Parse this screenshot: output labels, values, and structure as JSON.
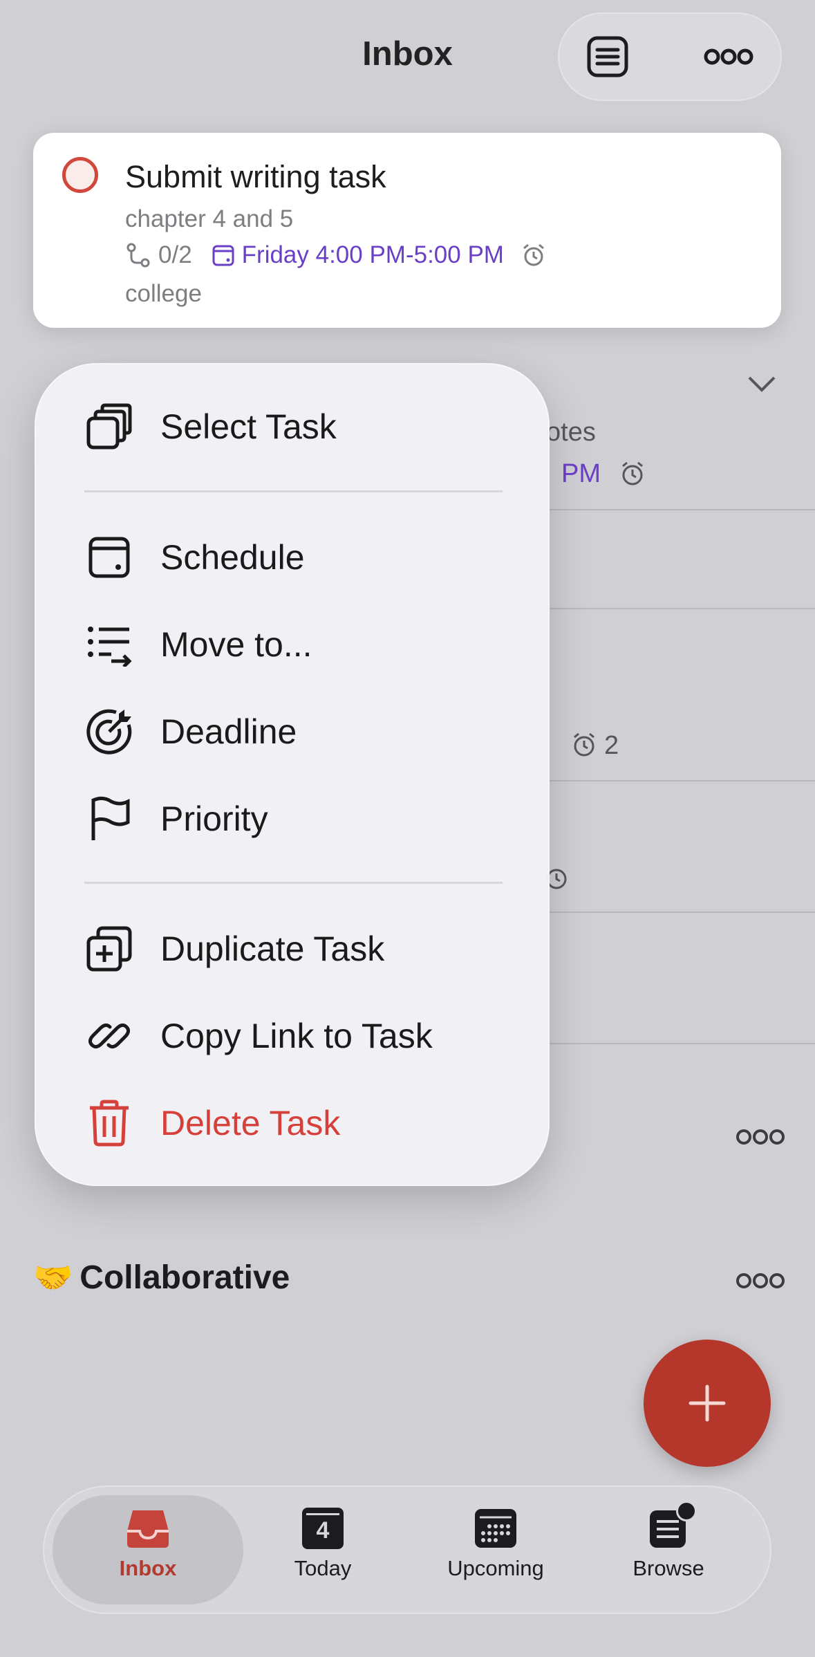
{
  "header": {
    "title": "Inbox"
  },
  "task_card": {
    "title": "Submit writing task",
    "description": "chapter 4 and 5",
    "subtasks": "0/2",
    "date": "Friday 4:00 PM-5:00 PM",
    "project": "college"
  },
  "background": {
    "notes_fragment": "otes",
    "pm_fragment": "PM",
    "reminder_count": "2"
  },
  "menu": {
    "select_task": "Select Task",
    "schedule": "Schedule",
    "move_to": "Move to...",
    "deadline": "Deadline",
    "priority": "Priority",
    "duplicate_task": "Duplicate Task",
    "copy_link": "Copy Link to Task",
    "delete_task": "Delete Task"
  },
  "section": {
    "collaborative": "Collaborative",
    "emoji": "🤝"
  },
  "tabs": {
    "inbox": "Inbox",
    "today": "Today",
    "today_day": "4",
    "upcoming": "Upcoming",
    "browse": "Browse"
  },
  "colors": {
    "accent_red": "#b5372c",
    "delete_red": "#d6403a",
    "date_purple": "#6a3fc8"
  }
}
